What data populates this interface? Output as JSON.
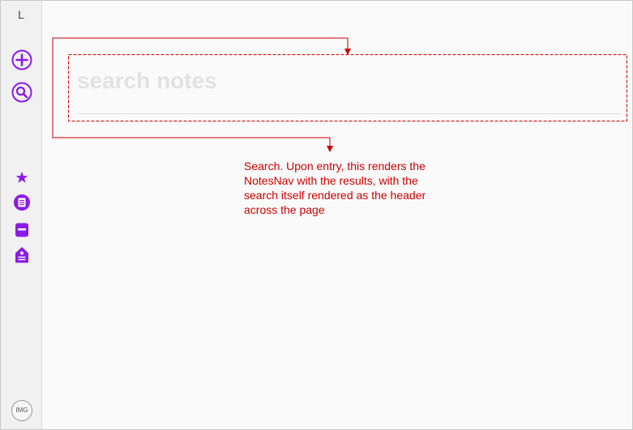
{
  "sidebar": {
    "logo": "L",
    "nav_icons": [
      "plus-icon",
      "search-icon",
      "star-icon",
      "notes-list-icon",
      "notebook-icon",
      "tag-icon"
    ],
    "avatar_label": "IMG"
  },
  "search": {
    "placeholder": "search notes",
    "value": ""
  },
  "annotation": {
    "text": "Search. Upon entry, this renders the NotesNav with the results, with the search itself rendered as the header across the page"
  },
  "colors": {
    "accent": "#8a1ce6",
    "annotation": "#cc0000",
    "sidebar_bg": "#f1f1f1",
    "page_bg": "#fafafa",
    "placeholder": "#e2e2e2"
  }
}
